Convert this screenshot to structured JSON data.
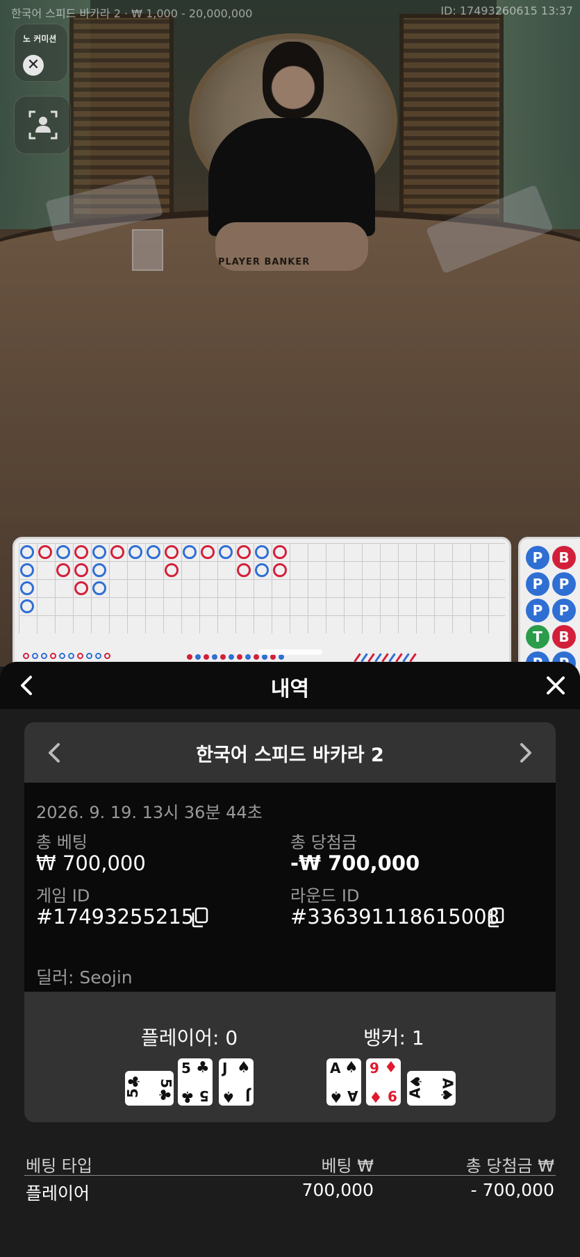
{
  "stream": {
    "table_info": "한국어 스피드 바카라 2 · ₩ 1,000 - 20,000,000",
    "session_info": "ID: 17493260615 13:37",
    "table_print": "PLAYER BANKER",
    "no_commission_label": "노 커미션"
  },
  "roadmap": {
    "colors": {
      "player": "#2f6fd4",
      "banker": "#d3203a",
      "tie": "#2b9c4a"
    },
    "bead_road": [
      "P",
      "B",
      "P",
      "P",
      "P",
      "P",
      "T",
      "B",
      "P",
      "P"
    ]
  },
  "sheet": {
    "title": "내역",
    "game_card": {
      "table_name": "한국어 스피드 바카라 2",
      "datetime": "2026. 9. 19. 13시 36분 44초",
      "total_bet_label": "총 베팅",
      "total_bet_value": "₩ 700,000",
      "total_win_label": "총 당첨금",
      "total_win_value": "-₩ 700,000",
      "game_id_label": "게임 ID",
      "game_id_value": "#17493255215",
      "round_id_label": "라운드 ID",
      "round_id_value": "#336391118615008",
      "dealer": "딜러: Seojin"
    },
    "result": {
      "player_label": "플레이어: 0",
      "banker_label": "뱅커: 1",
      "player_cards": [
        {
          "rank": "5",
          "suit": "♣",
          "color": "black",
          "rotated": true
        },
        {
          "rank": "5",
          "suit": "♣",
          "color": "black",
          "rotated": false
        },
        {
          "rank": "J",
          "suit": "♠",
          "color": "black",
          "rotated": false
        }
      ],
      "banker_cards": [
        {
          "rank": "A",
          "suit": "♠",
          "color": "black",
          "rotated": false
        },
        {
          "rank": "9",
          "suit": "♦",
          "color": "red",
          "rotated": false
        },
        {
          "rank": "A",
          "suit": "♠",
          "color": "black",
          "rotated": true
        }
      ]
    },
    "bet_table": {
      "headers": [
        "베팅 타입",
        "베팅 ₩",
        "총 당첨금 ₩"
      ],
      "rows": [
        {
          "type": "플레이어",
          "bet": "700,000",
          "win": "- 700,000"
        }
      ]
    }
  }
}
